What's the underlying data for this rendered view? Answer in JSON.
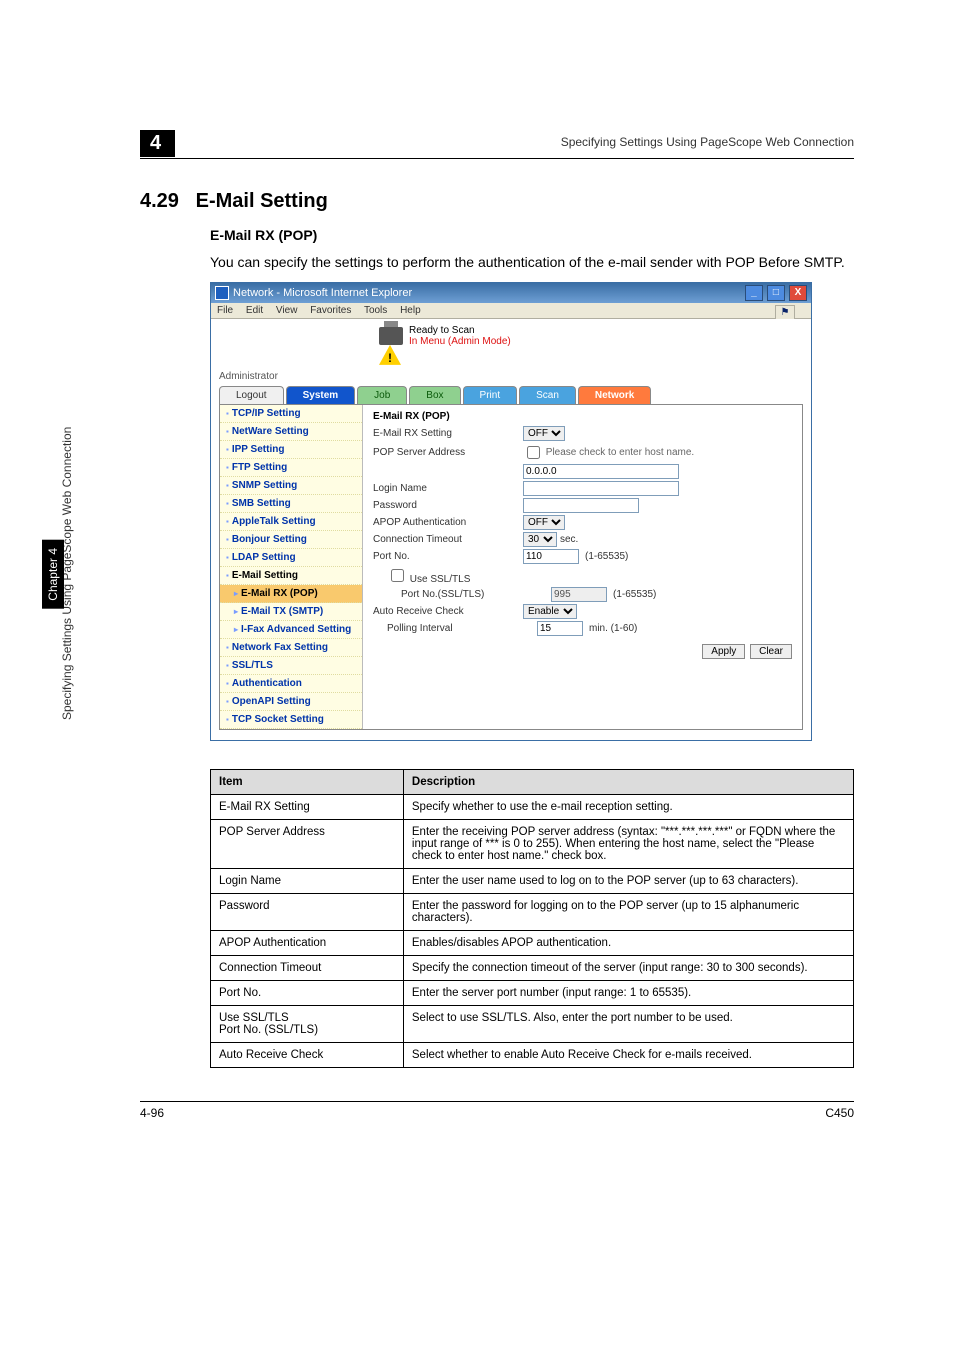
{
  "running_head": "Specifying Settings Using PageScope Web Connection",
  "chapter_mark": "4",
  "section_number": "4.29",
  "section_title": "E-Mail Setting",
  "subheading": "E-Mail RX (POP)",
  "intro_text": "You can specify the settings to perform the authentication of the e-mail sender with POP Before SMTP.",
  "ie": {
    "title": "Network - Microsoft Internet Explorer",
    "menus": [
      "File",
      "Edit",
      "View",
      "Favorites",
      "Tools",
      "Help"
    ],
    "status_line1": "Ready to Scan",
    "status_line2": "In Menu (Admin Mode)",
    "admin_label": "Administrator",
    "tabs": {
      "logout": "Logout",
      "system": "System",
      "job": "Job",
      "box": "Box",
      "print": "Print",
      "scan": "Scan",
      "network": "Network"
    },
    "sidebar": [
      {
        "label": "TCP/IP Setting",
        "type": "item"
      },
      {
        "label": "NetWare Setting",
        "type": "item"
      },
      {
        "label": "IPP Setting",
        "type": "item"
      },
      {
        "label": "FTP Setting",
        "type": "item"
      },
      {
        "label": "SNMP Setting",
        "type": "item"
      },
      {
        "label": "SMB Setting",
        "type": "item"
      },
      {
        "label": "AppleTalk Setting",
        "type": "item"
      },
      {
        "label": "Bonjour Setting",
        "type": "item"
      },
      {
        "label": "LDAP Setting",
        "type": "item"
      },
      {
        "label": "E-Mail Setting",
        "type": "item",
        "selected": true
      },
      {
        "label": "E-Mail RX (POP)",
        "type": "sub",
        "active": true
      },
      {
        "label": "E-Mail TX (SMTP)",
        "type": "sub"
      },
      {
        "label": "I-Fax Advanced Setting",
        "type": "sub"
      },
      {
        "label": "Network Fax Setting",
        "type": "item"
      },
      {
        "label": "SSL/TLS",
        "type": "item"
      },
      {
        "label": "Authentication",
        "type": "item"
      },
      {
        "label": "OpenAPI Setting",
        "type": "item"
      },
      {
        "label": "TCP Socket Setting",
        "type": "item"
      }
    ],
    "form": {
      "title": "E-Mail RX (POP)",
      "rows": {
        "rx_setting_label": "E-Mail RX Setting",
        "rx_setting_value": "OFF",
        "pop_server_label": "POP Server Address",
        "host_note": "Please check to enter host name.",
        "pop_server_value": "0.0.0.0",
        "login_label": "Login Name",
        "login_value": "",
        "password_label": "Password",
        "password_value": "",
        "apop_label": "APOP Authentication",
        "apop_value": "OFF",
        "timeout_label": "Connection Timeout",
        "timeout_value": "30",
        "timeout_unit": "sec.",
        "port_label": "Port No.",
        "port_value": "110",
        "port_range": "(1-65535)",
        "usessl_label": "Use SSL/TLS",
        "sslport_label": "Port No.(SSL/TLS)",
        "sslport_value": "995",
        "sslport_range": "(1-65535)",
        "autorecv_label": "Auto Receive Check",
        "autorecv_value": "Enable",
        "poll_label": "Polling Interval",
        "poll_value": "15",
        "poll_range": "min. (1-60)"
      },
      "buttons": {
        "apply": "Apply",
        "clear": "Clear"
      }
    }
  },
  "table": {
    "head_item": "Item",
    "head_desc": "Description",
    "rows": [
      {
        "item": "E-Mail RX Setting",
        "desc": "Specify whether to use the e-mail reception setting."
      },
      {
        "item": "POP Server Address",
        "desc": "Enter the receiving POP server address (syntax: \"***.***.***.***\" or FQDN where the input range of *** is 0 to 255). When entering the host name, select the \"Please check to enter host name.\" check box."
      },
      {
        "item": "Login Name",
        "desc": "Enter the user name used to log on to the POP server (up to 63 characters)."
      },
      {
        "item": "Password",
        "desc": "Enter the password for logging on to the POP server (up to 15 alphanumeric characters)."
      },
      {
        "item": "APOP Authentication",
        "desc": "Enables/disables APOP authentication."
      },
      {
        "item": "Connection Timeout",
        "desc": "Specify the connection timeout of the server (input range: 30 to 300 seconds)."
      },
      {
        "item": "Port No.",
        "desc": "Enter the server port number (input range: 1 to 65535)."
      },
      {
        "item": "Use SSL/TLS\nPort No. (SSL/TLS)",
        "desc": "Select to use SSL/TLS. Also, enter the port number to be used."
      },
      {
        "item": "Auto Receive Check",
        "desc": "Select whether to enable Auto Receive Check for e-mails received."
      }
    ]
  },
  "side_vertical": "Specifying Settings Using PageScope Web Connection",
  "chapter_tab": "Chapter 4",
  "footer_left": "4-96",
  "footer_right": "C450"
}
